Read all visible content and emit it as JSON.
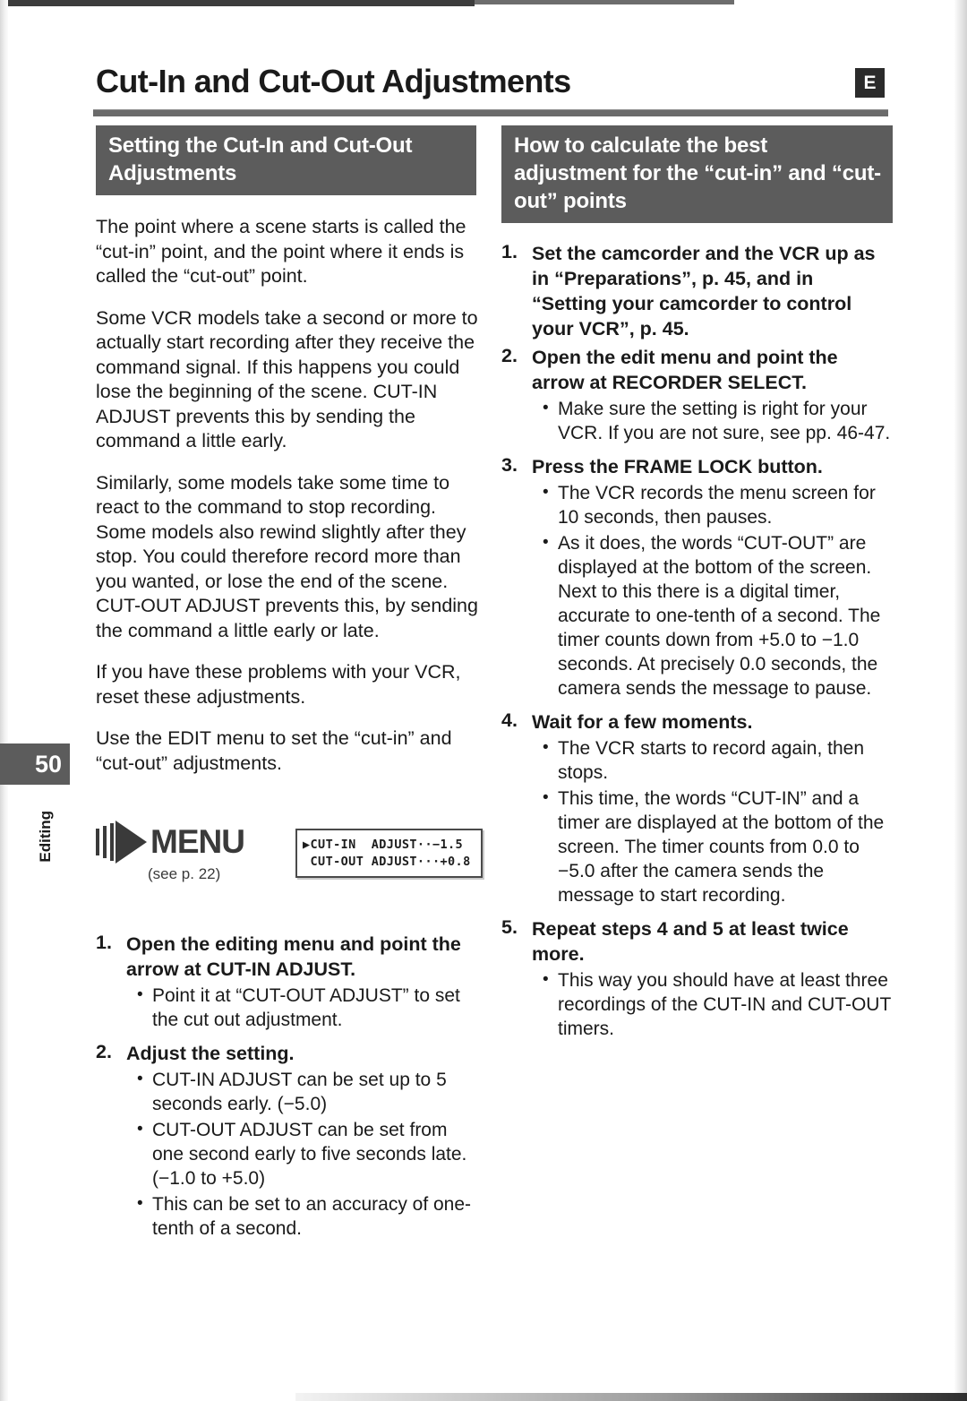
{
  "document": {
    "title": "Cut-In and Cut-Out Adjustments",
    "language_badge": "E",
    "page_number": "50",
    "section_label": "Editing"
  },
  "left_column": {
    "heading": "Setting the Cut-In and Cut-Out Adjustments",
    "paragraphs": [
      "The point where a scene starts is called the “cut-in” point, and the point where it ends is called the “cut-out” point.",
      "Some VCR models take a second or more to actually start recording after they receive the command signal. If this happens you could lose the beginning of the scene. CUT-IN ADJUST prevents this by sending the command a little early.",
      "Similarly, some models take some time to react to the command to stop recording. Some models also rewind slightly after they stop. You could therefore record more than you wanted, or lose the end of the scene. CUT-OUT ADJUST prevents this, by sending the command a little early or late.",
      "If you have these problems with your VCR, reset these adjustments.",
      "Use the EDIT menu to set the “cut-in” and “cut-out” adjustments."
    ],
    "menu_graphic": {
      "label": "MENU",
      "note": "(see p. 22)"
    },
    "lcd_display": {
      "line1": "▶CUT-IN  ADJUST··−1.5",
      "line2": " CUT-OUT ADJUST···+0.8"
    },
    "steps": [
      {
        "num": "1.",
        "title": "Open the editing menu and point the arrow at CUT-IN ADJUST.",
        "bullets": [
          "Point it at “CUT-OUT ADJUST” to set the cut out adjustment."
        ]
      },
      {
        "num": "2.",
        "title": "Adjust the setting.",
        "bullets": [
          "CUT-IN ADJUST can be set up to 5 seconds early. (−5.0)",
          "CUT-OUT ADJUST can be set from one second early to five seconds late. (−1.0 to +5.0)",
          "This can be set to an accuracy of one-tenth of a second."
        ]
      }
    ]
  },
  "right_column": {
    "heading": "How to calculate the best adjustment for  the “cut-in” and “cut-out” points",
    "steps": [
      {
        "num": "1.",
        "title": "Set the camcorder and the VCR up as in “Preparations”, p. 45, and in “Setting your camcorder to control your VCR”, p. 45.",
        "bullets": []
      },
      {
        "num": "2.",
        "title": "Open the edit menu and point the arrow at RECORDER SELECT.",
        "bullets": [
          "Make sure the setting is right for your VCR. If you are not sure, see pp. 46-47."
        ]
      },
      {
        "num": "3.",
        "title": "Press the FRAME LOCK button.",
        "bullets": [
          "The VCR records the menu screen for 10 seconds, then pauses.",
          "As it does, the words “CUT-OUT” are displayed at the bottom of the screen. Next to this there is a digital timer, accurate to one-tenth of a second. The timer counts down from +5.0 to −1.0 seconds. At precisely 0.0 seconds, the camera sends the message to pause."
        ]
      },
      {
        "num": "4.",
        "title": "Wait for a few moments.",
        "bullets": [
          "The VCR starts to record again, then stops.",
          "This time, the words “CUT-IN” and a timer are displayed at the bottom of the screen. The timer counts from 0.0 to −5.0 after the camera sends the message to start recording."
        ]
      },
      {
        "num": "5.",
        "title": "Repeat steps 4 and 5 at least twice more.",
        "bullets": [
          "This way you should have at least three recordings of the CUT-IN and CUT-OUT timers."
        ]
      }
    ]
  },
  "colors": {
    "heading_background": "#5c5c5c",
    "rule": "#6b6b6b",
    "badge_background": "#2b2b2b",
    "text": "#1a1a1a"
  }
}
